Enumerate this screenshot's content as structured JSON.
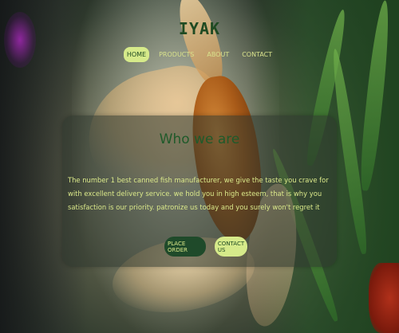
{
  "header": {
    "logo": "IYAK"
  },
  "nav": {
    "items": [
      {
        "label": "HOME",
        "active": true
      },
      {
        "label": "PRODUCTS",
        "active": false
      },
      {
        "label": "ABOUT",
        "active": false
      },
      {
        "label": "CONTACT",
        "active": false
      }
    ]
  },
  "hero": {
    "title": "Who we are",
    "description": "The number 1 best canned fish manufacturer, we give the taste you crave for with excellent delivery service. we hold you in high esteem, that is why you satisfaction is our priority. patronize us today and you surely won't regret it",
    "primary_button": "PLACE ORDER",
    "secondary_button": "CONTACT US"
  },
  "colors": {
    "accent": "#d6ea8a",
    "brand_dark": "#1f4a22"
  }
}
